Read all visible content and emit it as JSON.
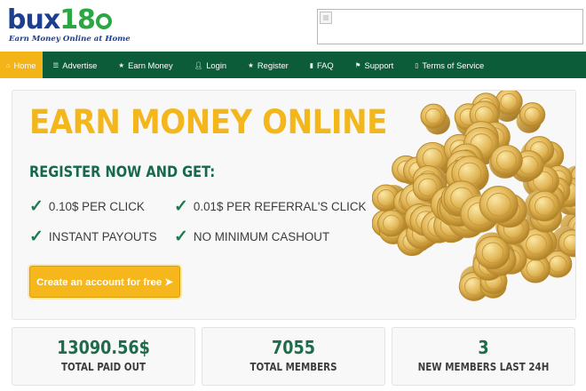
{
  "brand": {
    "name_text": "bux",
    "name_number": "18",
    "tagline": "Earn Money Online at Home"
  },
  "nav": {
    "items": [
      {
        "label": "Home",
        "icon": "home-icon",
        "active": true
      },
      {
        "label": "Advertise",
        "icon": "advertise-icon"
      },
      {
        "label": "Earn Money",
        "icon": "star-icon"
      },
      {
        "label": "Login",
        "icon": "user-icon"
      },
      {
        "label": "Register",
        "icon": "star-icon"
      },
      {
        "label": "FAQ",
        "icon": "book-icon"
      },
      {
        "label": "Support",
        "icon": "flag-icon"
      },
      {
        "label": "Terms of Service",
        "icon": "document-icon"
      }
    ]
  },
  "hero": {
    "title": "EARN MONEY ONLINE",
    "subtitle": "REGISTER NOW AND GET:",
    "features": [
      "0.10$ PER CLICK",
      "0.01$ PER REFERRAL'S CLICK",
      "INSTANT PAYOUTS",
      "NO MINIMUM CASHOUT"
    ],
    "cta_label": "Create an account for free ➤"
  },
  "stats": [
    {
      "value": "13090.56$",
      "label": "TOTAL PAID OUT"
    },
    {
      "value": "7055",
      "label": "TOTAL MEMBERS"
    },
    {
      "value": "3",
      "label": "NEW MEMBERS LAST 24H"
    }
  ],
  "colors": {
    "nav_bg": "#0c5c3a",
    "nav_active": "#f3b417",
    "accent_yellow": "#f4b71b",
    "accent_green": "#16694a",
    "brand_blue": "#1d3f8f"
  }
}
